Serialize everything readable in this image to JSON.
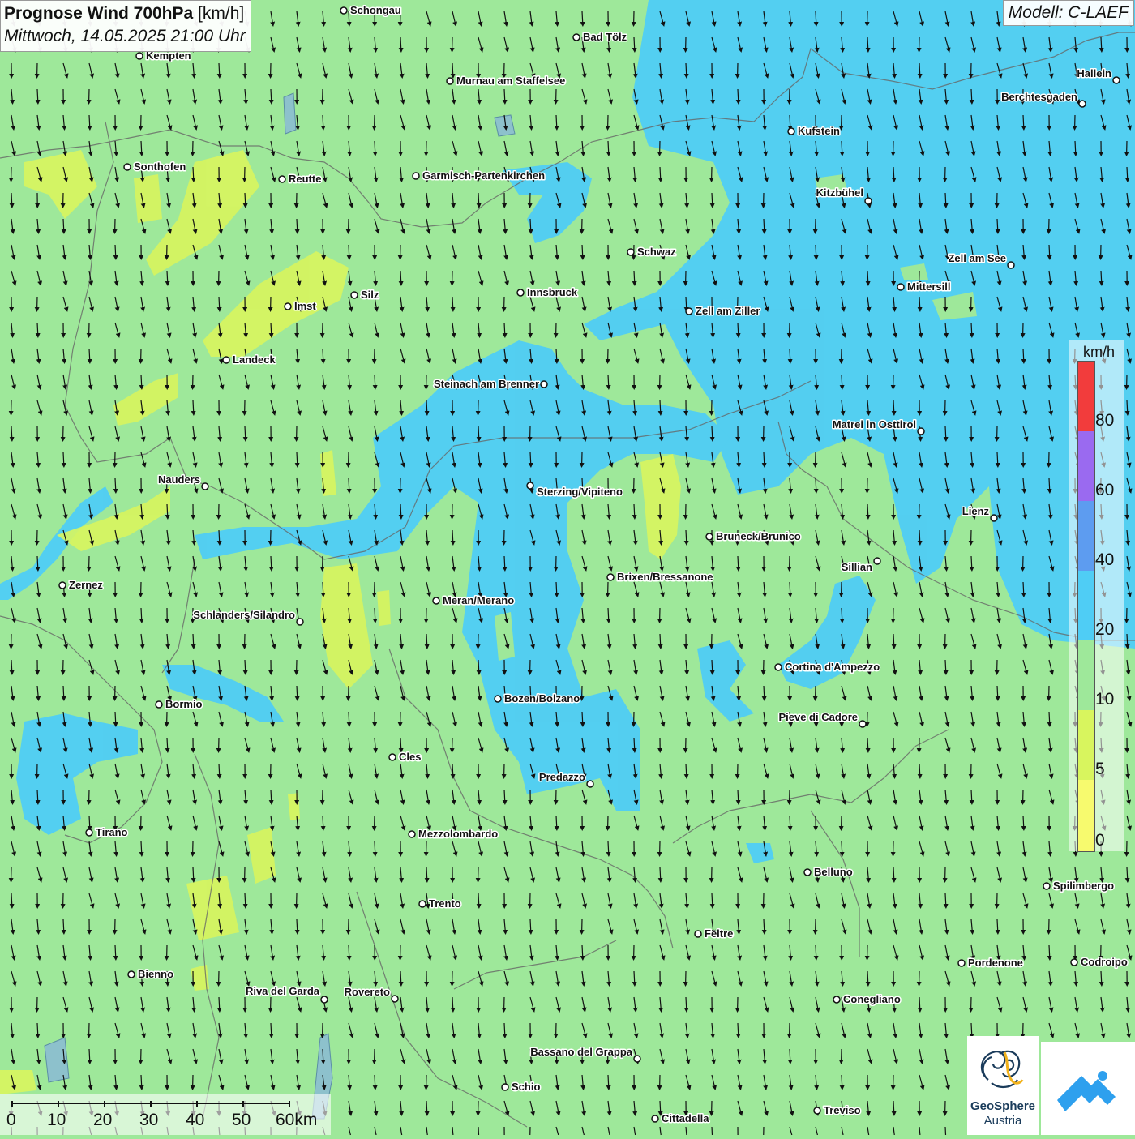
{
  "title": {
    "main_bold": "Prognose Wind 700hPa",
    "main_unit": "[km/h]",
    "subtitle": "Mittwoch, 14.05.2025 21:00 Uhr"
  },
  "model_label": "Modell: C-LAEF",
  "legend": {
    "unit": "km/h",
    "ticks": [
      "80",
      "60",
      "40",
      "20",
      "10",
      "5",
      "0"
    ],
    "classes": [
      {
        "from": 0,
        "to": 5,
        "color": "#f7fa6e"
      },
      {
        "from": 5,
        "to": 10,
        "color": "#d8f55e"
      },
      {
        "from": 10,
        "to": 20,
        "color": "#9ee89a"
      },
      {
        "from": 20,
        "to": 40,
        "color": "#4fcdf5"
      },
      {
        "from": 40,
        "to": 60,
        "color": "#5d9cf0"
      },
      {
        "from": 60,
        "to": 80,
        "color": "#9a6af0"
      },
      {
        "from": 80,
        "to": 100,
        "color": "#f23c3c"
      }
    ]
  },
  "wind_direction": "from north (arrows pointing south)",
  "scalebar": {
    "labels": [
      "0",
      "10",
      "20",
      "30",
      "40",
      "50",
      "60km"
    ]
  },
  "logos": {
    "geosphere_name": "GeoSphere",
    "geosphere_sub": "Austria",
    "app_icon": "mountain-app-icon"
  },
  "places": [
    {
      "name": "Schongau"
    },
    {
      "name": "Bad Tölz"
    },
    {
      "name": "Kempten"
    },
    {
      "name": "Murnau am Staffelsee"
    },
    {
      "name": "Hallein"
    },
    {
      "name": "Berchtesgaden"
    },
    {
      "name": "Kufstein"
    },
    {
      "name": "Sonthofen"
    },
    {
      "name": "Reutte"
    },
    {
      "name": "Garmisch-Partenkirchen"
    },
    {
      "name": "Kitzbühel"
    },
    {
      "name": "Schwaz"
    },
    {
      "name": "Zell am See"
    },
    {
      "name": "Mittersill"
    },
    {
      "name": "Silz"
    },
    {
      "name": "Innsbruck"
    },
    {
      "name": "Imst"
    },
    {
      "name": "Zell am Ziller"
    },
    {
      "name": "Landeck"
    },
    {
      "name": "Steinach am Brenner"
    },
    {
      "name": "Matrei in Osttirol"
    },
    {
      "name": "Nauders"
    },
    {
      "name": "Sterzing/Vipiteno"
    },
    {
      "name": "Lienz"
    },
    {
      "name": "Bruneck/Brunico"
    },
    {
      "name": "Sillian"
    },
    {
      "name": "Brixen/Bressanone"
    },
    {
      "name": "Zernez"
    },
    {
      "name": "Meran/Merano"
    },
    {
      "name": "Schlanders/Silandro"
    },
    {
      "name": "Cortina d'Ampezzo"
    },
    {
      "name": "Bozen/Bolzano"
    },
    {
      "name": "Bormio"
    },
    {
      "name": "Pieve di Cadore"
    },
    {
      "name": "Cles"
    },
    {
      "name": "Predazzo"
    },
    {
      "name": "Tirano"
    },
    {
      "name": "Mezzolombardo"
    },
    {
      "name": "Belluno"
    },
    {
      "name": "Spilimbergo"
    },
    {
      "name": "Trento"
    },
    {
      "name": "Feltre"
    },
    {
      "name": "Pordenone"
    },
    {
      "name": "Codroipo"
    },
    {
      "name": "Bienno"
    },
    {
      "name": "Riva del Garda"
    },
    {
      "name": "Rovereto"
    },
    {
      "name": "Conegliano"
    },
    {
      "name": "Bassano del Grappa"
    },
    {
      "name": "Schio"
    },
    {
      "name": "Treviso"
    },
    {
      "name": "Cittadella"
    }
  ]
}
